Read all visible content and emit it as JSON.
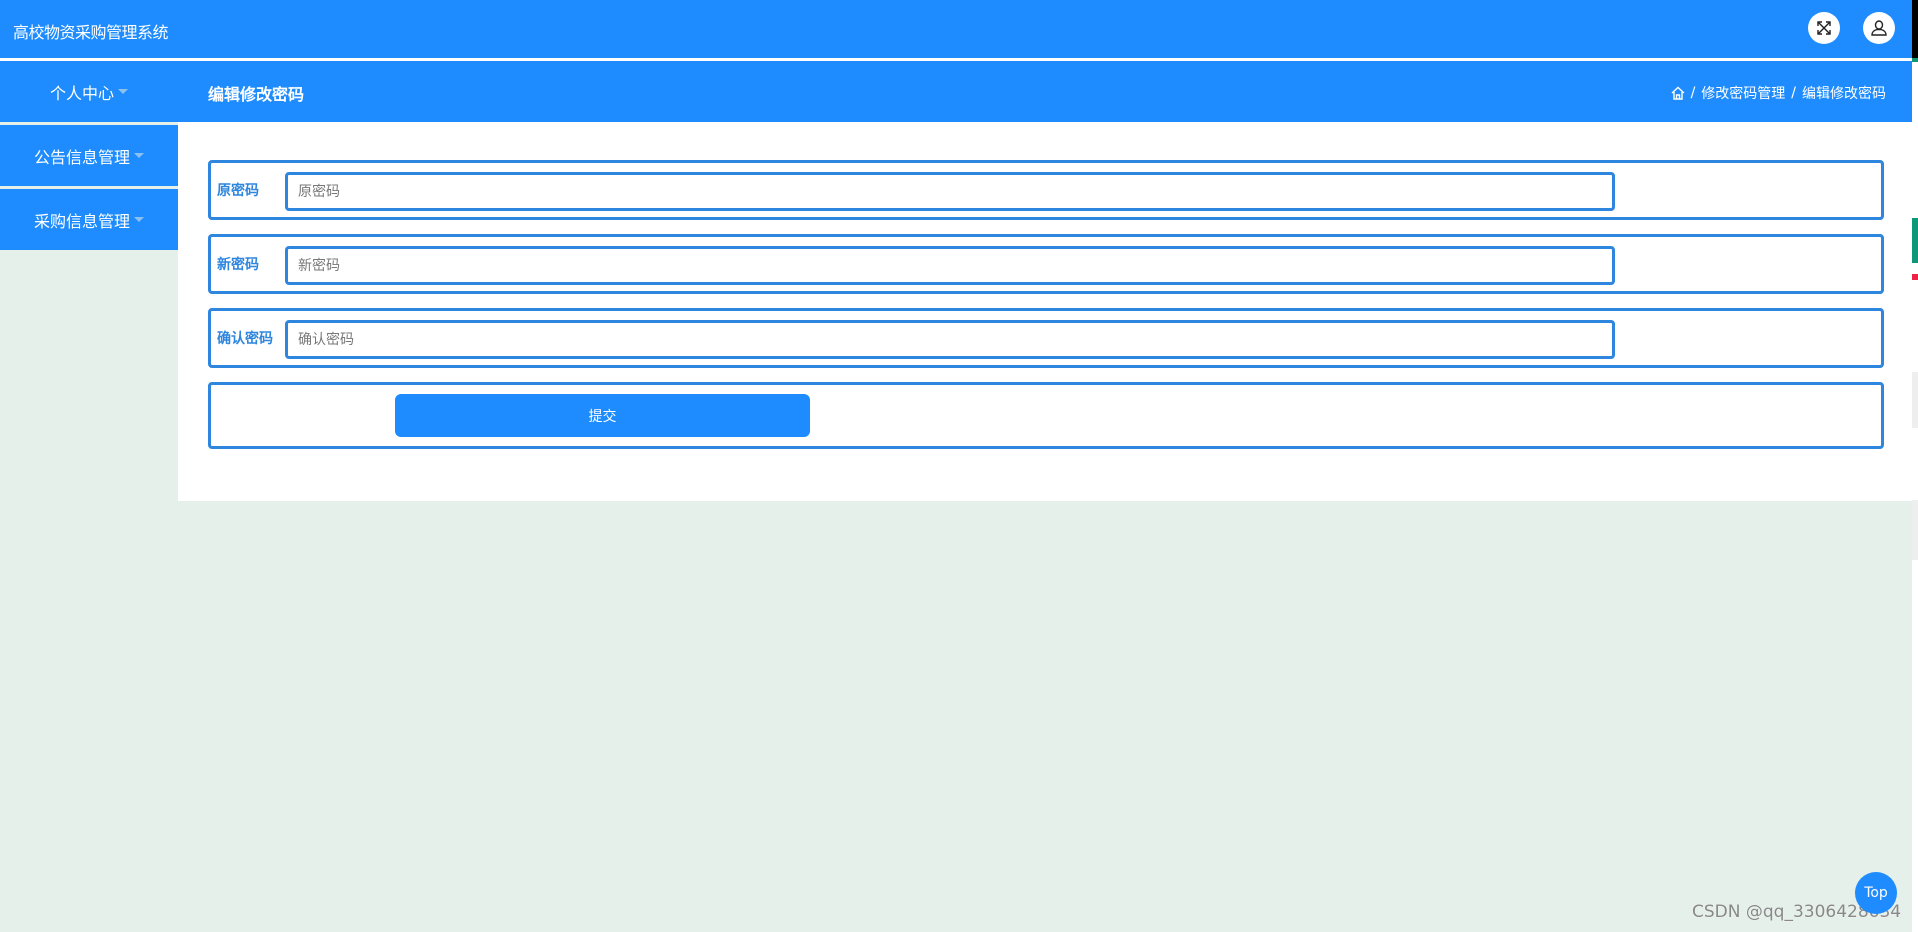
{
  "app": {
    "title": "高校物资采购管理系统"
  },
  "header_icons": {
    "fullscreen": "fullscreen-icon",
    "user": "user-icon"
  },
  "nav": {
    "first_menu": "个人中心",
    "page_heading": "编辑修改密码",
    "breadcrumb": {
      "home_icon": "home-icon",
      "separator": "/",
      "items": [
        "修改密码管理",
        "编辑修改密码"
      ]
    }
  },
  "sidebar": {
    "items": [
      {
        "label": "公告信息管理"
      },
      {
        "label": "采购信息管理"
      }
    ]
  },
  "form": {
    "fields": [
      {
        "label": "原密码",
        "placeholder": "原密码",
        "value": ""
      },
      {
        "label": "新密码",
        "placeholder": "新密码",
        "value": ""
      },
      {
        "label": "确认密码",
        "placeholder": "确认密码",
        "value": ""
      }
    ],
    "submit_label": "提交"
  },
  "footer": {
    "top_button": "Top",
    "watermark": "CSDN @qq_3306428634"
  },
  "colors": {
    "primary": "#1e8cfe",
    "border": "#2e86de",
    "background": "#e5f0eb"
  }
}
